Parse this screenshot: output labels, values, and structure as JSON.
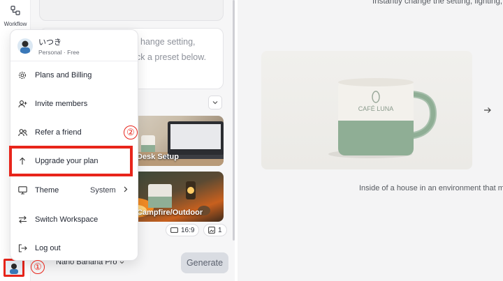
{
  "rail": {
    "workflow_label": "Workflow"
  },
  "prompt": {
    "line1": "hange setting,",
    "line2": "ck a preset below."
  },
  "presets": [
    {
      "label": "Desk Setup"
    },
    {
      "label": "Campfire/Outdoor"
    }
  ],
  "toolbar": {
    "ratio_label": "16:9",
    "count_label": "1",
    "model_label": "Nano Banana Pro",
    "generate_label": "Generate"
  },
  "preview": {
    "caption_top": "Instantly change the setting, lighting,",
    "mug_brand": "CAFÉ LUNA",
    "caption_bottom": "Inside of a house in an environment that make"
  },
  "account_menu": {
    "user_name": "いつき",
    "user_plan": "Personal · Free",
    "items": [
      {
        "label": "Plans and Billing",
        "icon": "gear-icon"
      },
      {
        "label": "Invite members",
        "icon": "add-user-icon"
      },
      {
        "label": "Refer a friend",
        "icon": "users-icon"
      },
      {
        "label": "Upgrade your plan",
        "icon": "arrow-up-icon"
      },
      {
        "label": "Theme",
        "value": "System",
        "icon": "monitor-icon"
      },
      {
        "label": "Switch Workspace",
        "icon": "switch-icon"
      },
      {
        "label": "Log out",
        "icon": "logout-icon"
      }
    ]
  },
  "annotations": {
    "marker_1": "①",
    "marker_2": "②"
  },
  "colors": {
    "highlight": "#e8251b",
    "mug_green": "#8fae95",
    "panel_bg": "#f6f6f7"
  }
}
